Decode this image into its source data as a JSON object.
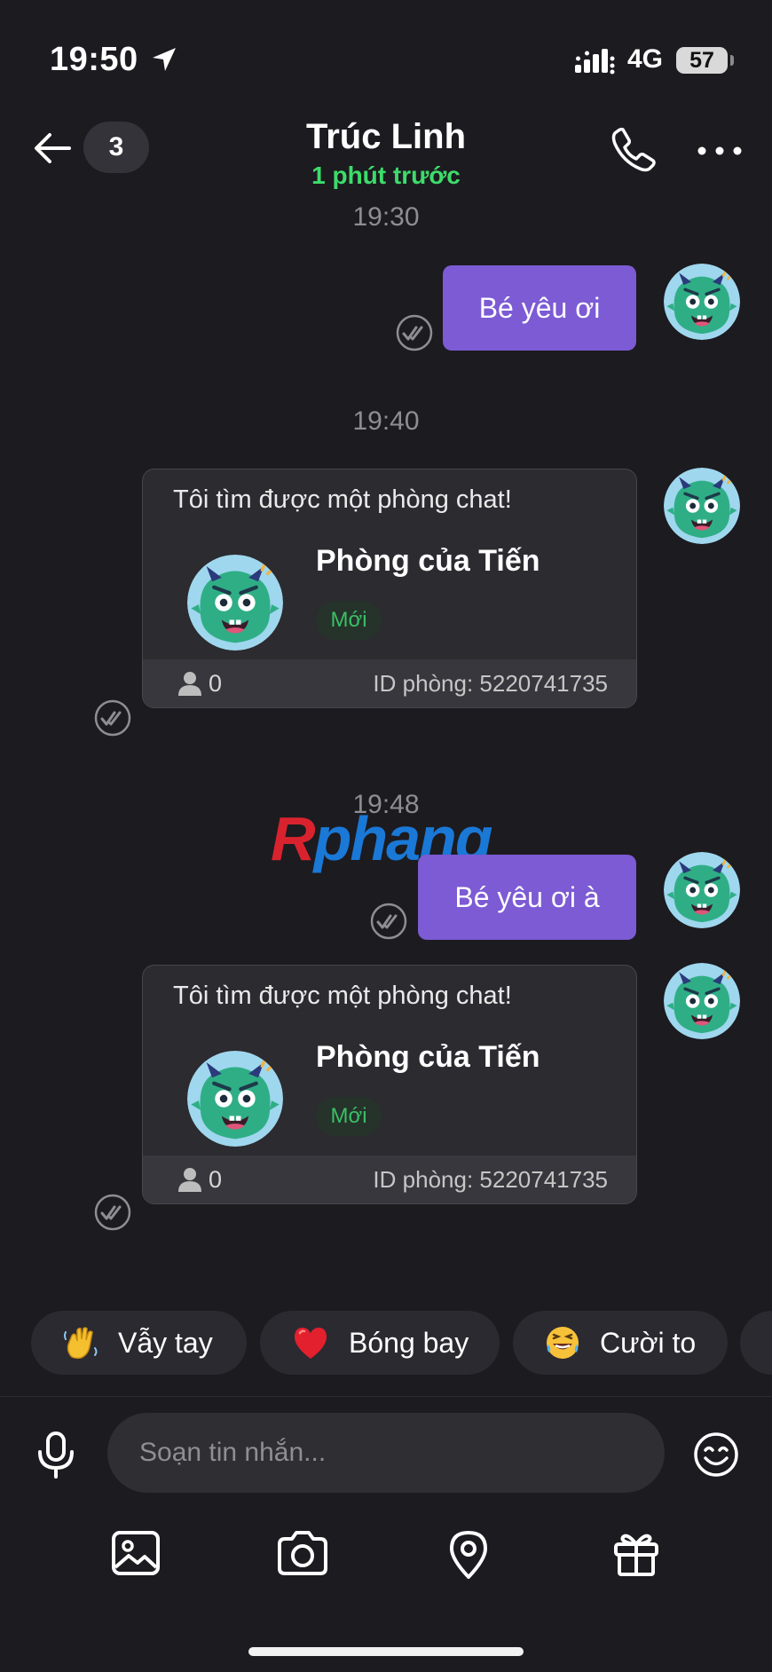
{
  "status_bar": {
    "time": "19:50",
    "network": "4G",
    "battery": "57"
  },
  "header": {
    "unread_count": "3",
    "contact_name": "Trúc Linh",
    "contact_status": "1 phút trước"
  },
  "messages": {
    "time_1": "19:30",
    "bubble_1": "Bé yêu ơi",
    "time_2": "19:40",
    "time_3": "19:48",
    "bubble_2": "Bé yêu ơi à"
  },
  "room_card": {
    "intro": "Tôi tìm được một phòng chat!",
    "room_name": "Phòng của Tiến",
    "badge": "Mới",
    "member_count": "0",
    "room_id": "ID phòng: 5220741735"
  },
  "watermark": {
    "part_a": "R",
    "part_b": "phang"
  },
  "reactions": [
    {
      "label": "Vẫy tay",
      "icon": "waving-hand-icon"
    },
    {
      "label": "Bóng bay",
      "icon": "heart-balloon-icon"
    },
    {
      "label": "Cười to",
      "icon": "laughing-face-icon"
    }
  ],
  "composer": {
    "placeholder": "Soạn tin nhắn..."
  },
  "toolbar": [
    "image-icon",
    "camera-icon",
    "location-icon",
    "gift-icon"
  ],
  "colors": {
    "accent": "#7c5bd4",
    "online": "#3ddc6a",
    "background": "#1c1b20"
  }
}
